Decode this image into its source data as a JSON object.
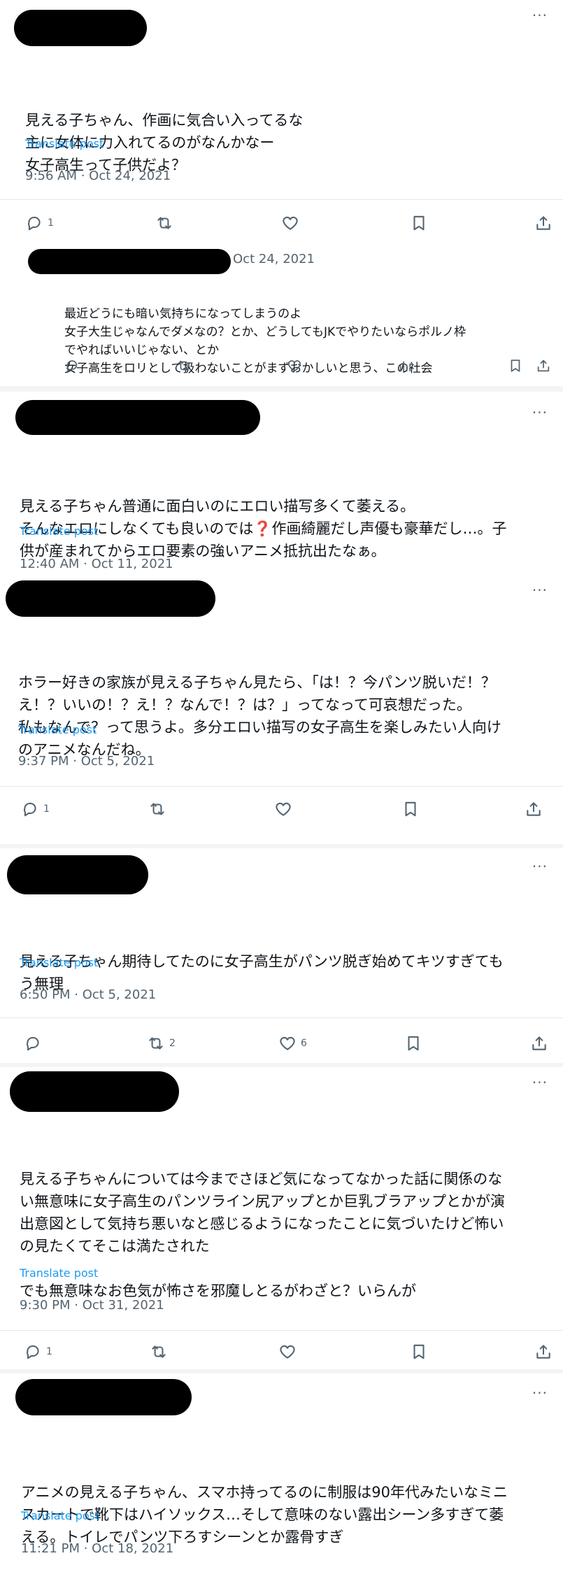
{
  "posts": [
    {
      "lines": [
        "見える子ちゃん、作画に気合い入ってるな",
        "主に女体に力入れてるのがなんかなー",
        "女子高生って子供だよ？"
      ],
      "translate": "Translate post",
      "timestamp": "9:56 AM · Oct 24, 2021",
      "reply_count": "1",
      "repost_count": "",
      "like_count": ""
    },
    {
      "date": "Oct 24, 2021",
      "lines": [
        "最近どうにも暗い気持ちになってしまうのよ",
        "女子大生じゃなんでダメなの？とか、どうしてもJKでやりたいならポルノ枠",
        "でやればいいじゃない、とか",
        "女子高生をロリとして扱わないことがまずおかしいと思う、この社会"
      ]
    },
    {
      "lines": [
        "見える子ちゃん普通に面白いのにエロい描写多くて萎える。",
        "そんなエロにしなくても良いのでは❓作画綺麗だし声優も豪華だし…。子",
        "供が産まれてからエロ要素の強いアニメ抵抗出たなぁ。"
      ],
      "translate": "Translate post",
      "timestamp": "12:40 AM · Oct 11, 2021"
    },
    {
      "lines": [
        "ホラー好きの家族が見える子ちゃん見たら、「は！？今パンツ脱いだ！？",
        "え！？いいの！？え！？なんで！？は？」ってなって可哀想だった。",
        "私もなんで？って思うよ。多分エロい描写の女子高生を楽しみたい人向け",
        "のアニメなんだね。"
      ],
      "translate": "Translate post",
      "timestamp": "9:37 PM · Oct 5, 2021",
      "reply_count": "1"
    },
    {
      "lines": [
        "見える子ちゃん期待してたのに女子高生がパンツ脱ぎ始めてキツすぎても",
        "う無理"
      ],
      "translate": "Translate post",
      "timestamp": "6:50 PM · Oct 5, 2021",
      "repost_count": "2",
      "like_count": "6"
    },
    {
      "lines": [
        "見える子ちゃんについては今までさほど気になってなかった話に関係のな",
        "い無意味に女子高生のパンツライン尻アップとか巨乳ブラアップとかが演",
        "出意図として気持ち悪いなと感じるようになったことに気づいたけど怖い",
        "の見たくてそこは満たされた",
        "",
        "でも無意味なお色気が怖さを邪魔しとるがわざと？いらんが"
      ],
      "translate": "Translate post",
      "timestamp": "9:30 PM · Oct 31, 2021",
      "reply_count": "1"
    },
    {
      "lines": [
        "アニメの見える子ちゃん、スマホ持ってるのに制服は90年代みたいなミニ",
        "スカートで靴下はハイソックス…そして意味のない露出シーン多すぎて萎",
        "える。トイレでパンツ下ろすシーンとか露骨すぎ"
      ],
      "translate": "Translate post",
      "timestamp": "11:21 PM · Oct 18, 2021"
    }
  ],
  "more_glyph": "···",
  "icons": [
    "reply-icon",
    "repost-icon",
    "like-icon",
    "bookmark-icon",
    "share-icon",
    "views-icon",
    "more-icon"
  ]
}
